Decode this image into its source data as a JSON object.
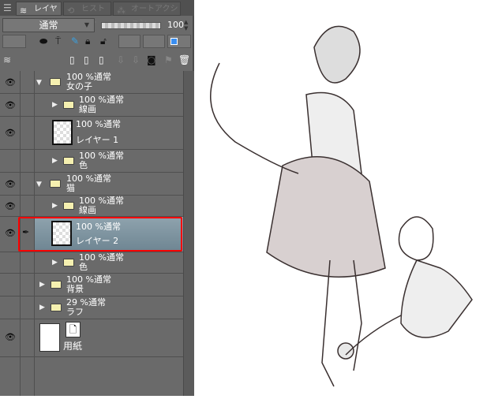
{
  "tabs": [
    {
      "label": "レイヤー",
      "icon": "layers-icon"
    },
    {
      "label": "ヒストリー",
      "icon": "history-icon"
    },
    {
      "label": "オートアクション",
      "icon": "auto-action-icon"
    }
  ],
  "blend_mode": "通常",
  "opacity": "100",
  "layers": [
    {
      "opacity_mode": "100 %通常",
      "name": "女の子",
      "type": "folder-open",
      "visible": true
    },
    {
      "opacity_mode": "100 %通常",
      "name": "線画",
      "type": "folder",
      "visible": true
    },
    {
      "opacity_mode": "100 %通常",
      "name": "レイヤー 1",
      "type": "raster",
      "visible": true
    },
    {
      "opacity_mode": "100 %通常",
      "name": "色",
      "type": "folder",
      "visible": true
    },
    {
      "opacity_mode": "100 %通常",
      "name": "猫",
      "type": "folder-open",
      "visible": true
    },
    {
      "opacity_mode": "100 %通常",
      "name": "線画",
      "type": "folder",
      "visible": true
    },
    {
      "opacity_mode": "100 %通常",
      "name": "レイヤー 2",
      "type": "raster",
      "visible": true,
      "selected": true
    },
    {
      "opacity_mode": "100 %通常",
      "name": "色",
      "type": "folder",
      "visible": false
    },
    {
      "opacity_mode": "100 %通常",
      "name": "背景",
      "type": "folder",
      "visible": false
    },
    {
      "opacity_mode": "29 %通常",
      "name": "ラフ",
      "type": "folder",
      "visible": false
    },
    {
      "opacity_mode": "",
      "name": "用紙",
      "type": "paper",
      "visible": true
    }
  ],
  "colors": {
    "panel": "#6a6a6a",
    "selected": "#7f95a1",
    "highlight": "#ff0000"
  }
}
